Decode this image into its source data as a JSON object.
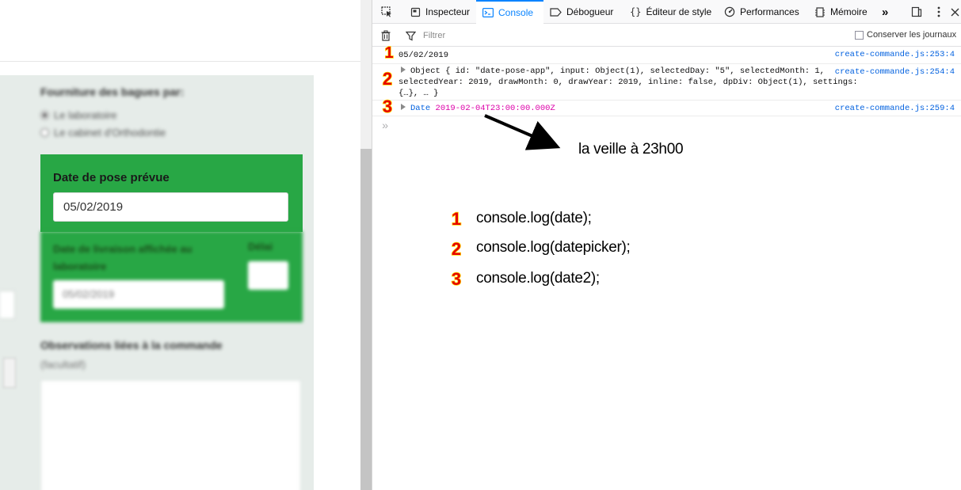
{
  "left_panel": {
    "fourniture_heading": "Fourniture des bagues par:",
    "radio_options": [
      "Le laboratoire",
      "Le cabinet d'Orthodontie"
    ],
    "date_pose_label": "Date de pose prévue",
    "date_pose_value": "05/02/2019",
    "date_livraison_label": "Date de livraison affichée au laboratoire",
    "delai_label": "Délai",
    "date_livraison_value": "05/02/2019",
    "observations_heading": "Observations liées à la commande",
    "observations_sub": "(facultatif)"
  },
  "devtools": {
    "tabs": [
      {
        "label": "Inspecteur",
        "icon": "inspector-icon"
      },
      {
        "label": "Console",
        "icon": "console-icon",
        "active": true
      },
      {
        "label": "Débogueur",
        "icon": "debugger-icon"
      },
      {
        "label": "Éditeur de style",
        "icon": "style-editor-icon"
      },
      {
        "label": "Performances",
        "icon": "performance-icon"
      },
      {
        "label": "Mémoire",
        "icon": "memory-icon"
      }
    ],
    "more_tabs_glyph": "»",
    "filter_placeholder": "Filtrer",
    "persist_logs_label": "Conserver les journaux",
    "logs": [
      {
        "text": "05/02/2019",
        "source": "create-commande.js:253:4"
      },
      {
        "line1": "Object { id: \"date-pose-app\", input: Object(1), selectedDay: \"5\", selectedMonth: 1,",
        "line2": "selectedYear: 2019, drawMonth: 0, drawYear: 2019, inline: false, dpDiv: Object(1), settings:",
        "line3": "{…}, … }",
        "source": "create-commande.js:254:4"
      },
      {
        "prefix": "Date",
        "value": "2019-02-04T23:00:00.000Z",
        "source": "create-commande.js:259:4"
      }
    ],
    "prompt": "»"
  },
  "annotations": {
    "badges": [
      "1",
      "2",
      "3"
    ],
    "arrow_note": "la veille à 23h00",
    "legend": [
      {
        "num": "1",
        "code": "console.log(date);"
      },
      {
        "num": "2",
        "code": "console.log(datepicker);"
      },
      {
        "num": "3",
        "code": "console.log(date2);"
      }
    ]
  },
  "colors": {
    "accent": "#0a84ff",
    "green": "#28a745",
    "badge_red": "#e60000",
    "badge_yellow": "#ffe000",
    "source_link": "#0060df"
  }
}
